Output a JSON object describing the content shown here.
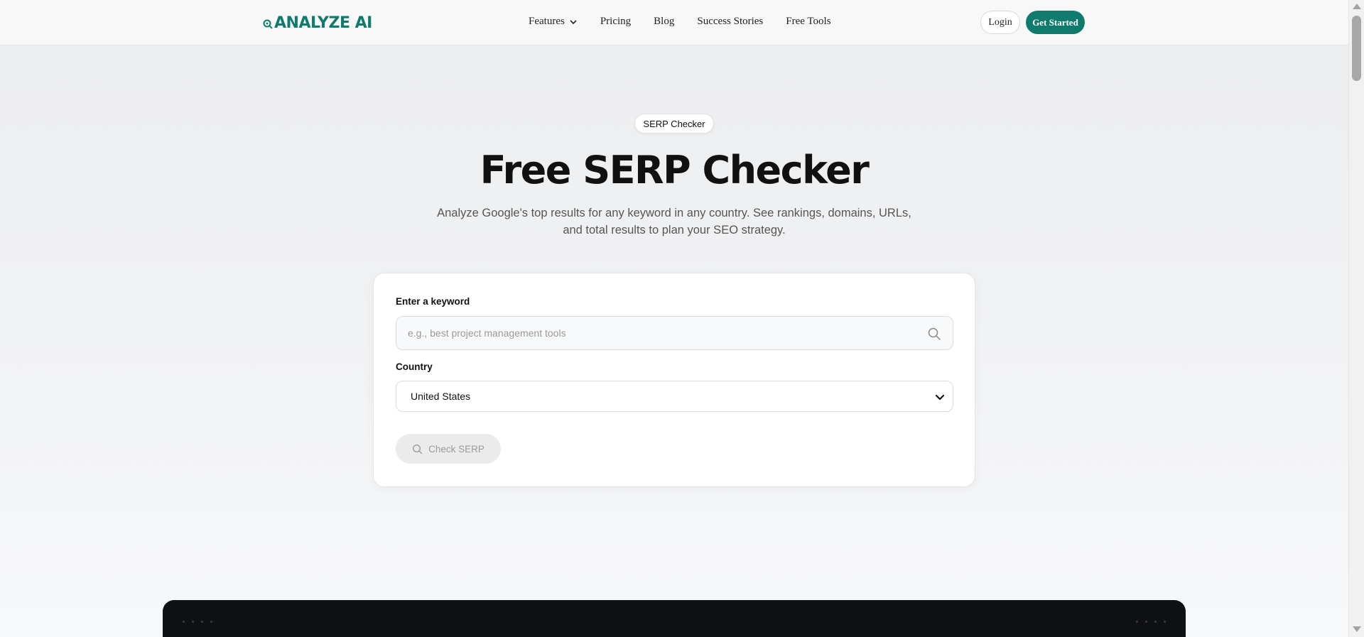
{
  "header": {
    "logo_text": "ANALYZE AI",
    "nav": [
      {
        "label": "Features",
        "has_dropdown": true
      },
      {
        "label": "Pricing"
      },
      {
        "label": "Blog"
      },
      {
        "label": "Success Stories"
      },
      {
        "label": "Free Tools"
      }
    ],
    "login_label": "Login",
    "get_started_label": "Get Started"
  },
  "hero": {
    "badge": "SERP Checker",
    "title": "Free SERP Checker",
    "subtitle": "Analyze Google's top results for any keyword in any country. See rankings, domains, URLs, and total results to plan your SEO strategy."
  },
  "form": {
    "keyword_label": "Enter a keyword",
    "keyword_placeholder": "e.g., best project management tools",
    "keyword_value": "",
    "country_label": "Country",
    "country_value": "United States",
    "check_label": "Check SERP",
    "check_disabled": true
  },
  "colors": {
    "brand": "#0f7b6c",
    "dark_section": "#101112"
  },
  "icons": [
    "logo-icon",
    "chevron-down-icon",
    "search-icon",
    "select-chevron-icon"
  ]
}
